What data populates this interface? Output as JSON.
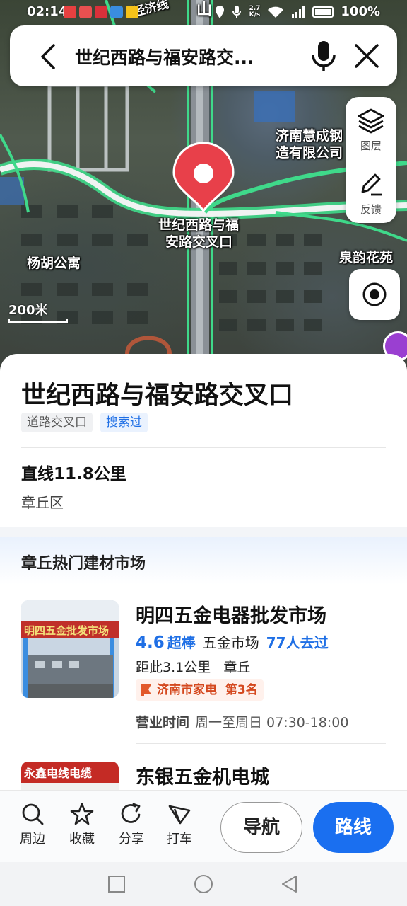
{
  "status_bar": {
    "time": "02:14",
    "speed_value": "2.7",
    "speed_unit": "K/s",
    "battery": "100%"
  },
  "search": {
    "query": "世纪西路与福安路交..."
  },
  "map": {
    "tools": [
      {
        "label": "图层",
        "icon": "layers-icon"
      },
      {
        "label": "反馈",
        "icon": "pencil-icon"
      }
    ],
    "labels": {
      "company_line1": "济南慧成钢",
      "company_line2": "造有限公司",
      "marker_line1": "世纪西路与福",
      "marker_line2": "安路交叉口",
      "apartment": "杨胡公寓",
      "garden": "泉韵花苑",
      "road_top": "经济线",
      "shan": "山"
    },
    "scale": "200米"
  },
  "place": {
    "title": "世纪西路与福安路交叉口",
    "tag_type": "道路交叉口",
    "tag_searched": "搜索过",
    "distance": "直线11.8公里",
    "district": "章丘区"
  },
  "section": {
    "title": "章丘热门建材市场"
  },
  "cards": [
    {
      "name": "明四五金电器批发市场",
      "rating": "4.6",
      "rating_word": "超棒",
      "category": "五金市场",
      "visited": "77人去过",
      "distance": "距此3.1公里",
      "area": "章丘",
      "rank_region": "济南市家电",
      "rank_pos": "第3名",
      "hours_label": "营业时间",
      "hours_value": "周一至周日 07:30-18:00",
      "image_sign": "明四五金批发市场"
    },
    {
      "name": "东银五金机电城",
      "image_sign": "永鑫电线电缆"
    }
  ],
  "bottom_bar": {
    "items": [
      {
        "label": "周边",
        "icon": "search-icon"
      },
      {
        "label": "收藏",
        "icon": "star-icon"
      },
      {
        "label": "分享",
        "icon": "share-icon"
      },
      {
        "label": "打车",
        "icon": "taxi-icon"
      }
    ],
    "nav_label": "导航",
    "route_label": "路线"
  },
  "colors": {
    "accent": "#1a6ff0",
    "marker": "#e8404a",
    "rank_text": "#d4481e",
    "route_green": "#3fd98a"
  }
}
